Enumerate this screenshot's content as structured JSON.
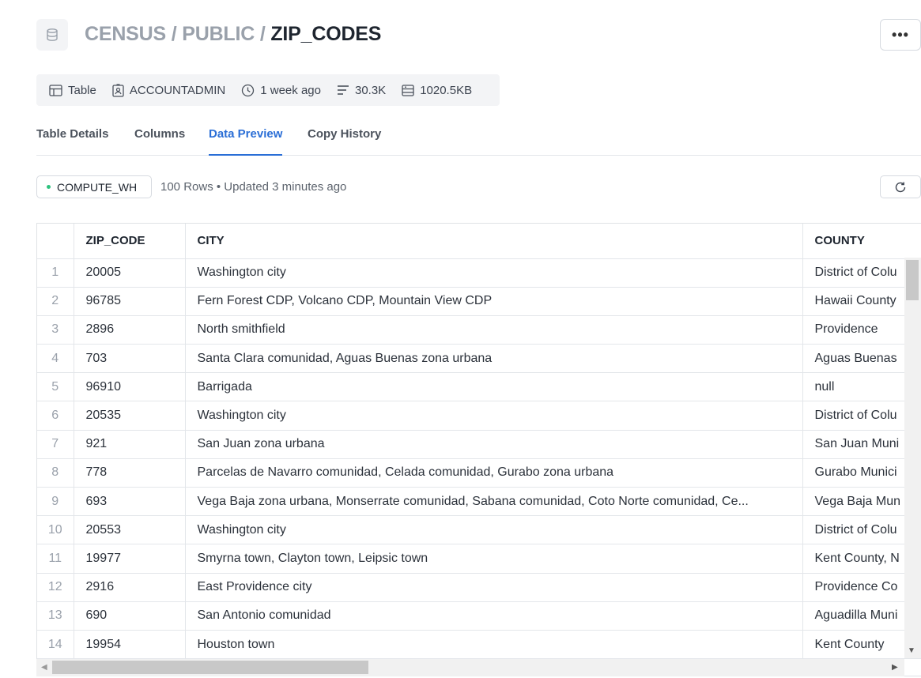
{
  "header": {
    "breadcrumb": [
      "CENSUS",
      "PUBLIC"
    ],
    "separator": " / ",
    "title": "ZIP_CODES",
    "more_label": "•••"
  },
  "meta": {
    "type": "Table",
    "owner": "ACCOUNTADMIN",
    "modified": "1 week ago",
    "row_count": "30.3K",
    "size": "1020.5KB"
  },
  "tabs": [
    {
      "label": "Table Details",
      "active": false
    },
    {
      "label": "Columns",
      "active": false
    },
    {
      "label": "Data Preview",
      "active": true
    },
    {
      "label": "Copy History",
      "active": false
    }
  ],
  "preview": {
    "warehouse": "COMPUTE_WH",
    "info": "100 Rows • Updated 3 minutes ago"
  },
  "table": {
    "columns": [
      "",
      "ZIP_CODE",
      "CITY",
      "COUNTY"
    ],
    "rows": [
      [
        "1",
        "20005",
        "Washington city",
        "District of Colu"
      ],
      [
        "2",
        "96785",
        "Fern Forest CDP, Volcano CDP, Mountain View CDP",
        "Hawaii County"
      ],
      [
        "3",
        "2896",
        "North smithfield",
        "Providence"
      ],
      [
        "4",
        "703",
        "Santa Clara comunidad, Aguas Buenas zona urbana",
        "Aguas Buenas"
      ],
      [
        "5",
        "96910",
        "Barrigada",
        "null"
      ],
      [
        "6",
        "20535",
        "Washington city",
        "District of Colu"
      ],
      [
        "7",
        "921",
        "San Juan zona urbana",
        "San Juan Muni"
      ],
      [
        "8",
        "778",
        "Parcelas de Navarro comunidad, Celada comunidad, Gurabo zona urbana",
        "Gurabo Munici"
      ],
      [
        "9",
        "693",
        "Vega Baja zona urbana, Monserrate comunidad, Sabana comunidad, Coto Norte comunidad, Ce...",
        "Vega Baja Mun"
      ],
      [
        "10",
        "20553",
        "Washington city",
        "District of Colu"
      ],
      [
        "11",
        "19977",
        "Smyrna town, Clayton town, Leipsic town",
        "Kent County, N"
      ],
      [
        "12",
        "2916",
        "East Providence city",
        "Providence Co"
      ],
      [
        "13",
        "690",
        "San Antonio comunidad",
        "Aguadilla Muni"
      ],
      [
        "14",
        "19954",
        "Houston town",
        "Kent County"
      ]
    ]
  },
  "colors": {
    "accent": "#2a6ed6",
    "status_running": "#2ec27e"
  }
}
